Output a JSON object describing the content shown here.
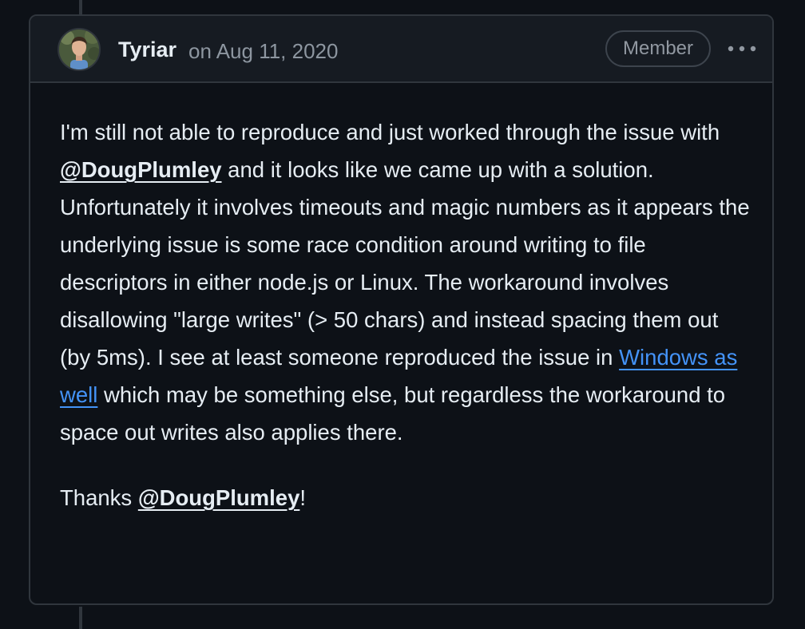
{
  "comment": {
    "author": "Tyriar",
    "timestamp": "on Aug 11, 2020",
    "role_badge": "Member",
    "menu_icon": "kebab-horizontal-icon",
    "avatar_icon": "avatar-photo",
    "body": {
      "p1_seg1": "I'm still not able to reproduce and just worked through the issue with ",
      "mention_1": "@DougPlumley",
      "p1_seg2": " and it looks like we came up with a solution. Unfortunately it involves timeouts and magic numbers as it appears the underlying issue is some race condition around writing to file descriptors in either node.js or Linux. The workaround involves disallowing \"large writes\" (> 50 chars) and instead spacing them out (by 5ms). I see at least someone reproduced the issue in ",
      "link_text": "Windows as well",
      "p1_seg3": " which may be something else, but regardless the workaround to space out writes also applies there.",
      "p2_seg1": "Thanks ",
      "mention_2": "@DougPlumley",
      "p2_seg2": "!"
    }
  },
  "colors": {
    "background": "#0d1117",
    "header_background": "#161b22",
    "border": "#30363d",
    "text": "#e6edf3",
    "muted_text": "#8d96a0",
    "link": "#4493f8"
  }
}
